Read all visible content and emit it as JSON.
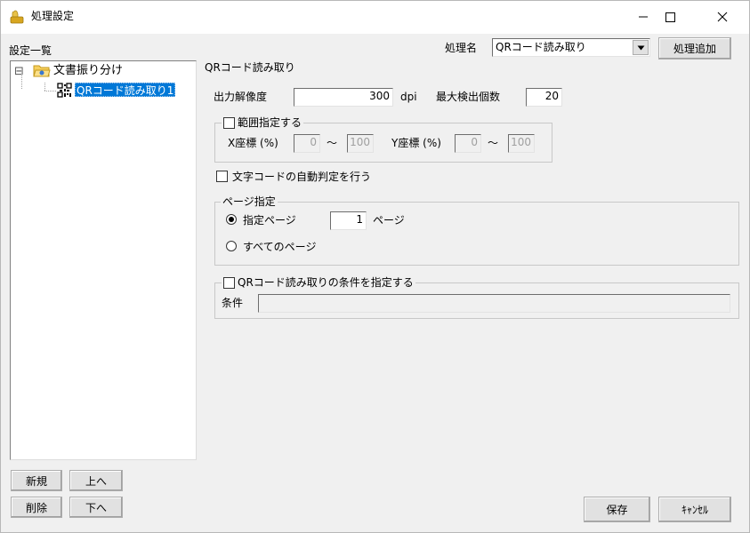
{
  "window": {
    "title": "処理設定"
  },
  "sidebar": {
    "heading": "設定一覧",
    "tree": {
      "root_label": "文書振り分け",
      "root_toggle": "⊟",
      "child_label": "QRコード読み取り1"
    },
    "buttons": {
      "new": "新規",
      "up": "上へ",
      "delete": "削除",
      "down": "下へ"
    }
  },
  "header": {
    "process_name_label": "処理名",
    "process_name_value": "QRコード読み取り",
    "add_button": "処理追加"
  },
  "panel": {
    "title": "QRコード読み取り",
    "resolution_label": "出力解像度",
    "resolution_value": "300",
    "resolution_unit": "dpi",
    "max_detect_label": "最大検出個数",
    "max_detect_value": "20",
    "range": {
      "label": "範囲指定する",
      "x_label": "X座標 (%)",
      "x_from": "0",
      "tilde": "～",
      "x_to": "100",
      "y_label": "Y座標 (%)",
      "y_from": "0",
      "y_to": "100"
    },
    "auto_charcode_label": "文字コードの自動判定を行う",
    "page": {
      "group_label": "ページ指定",
      "specified_label": "指定ページ",
      "page_value": "1",
      "page_unit": "ページ",
      "all_pages_label": "すべてのページ"
    },
    "condition": {
      "check_label": "QRコード読み取りの条件を指定する",
      "field_label": "条件",
      "field_value": ""
    }
  },
  "footer": {
    "save": "保存",
    "cancel": "ｷｬﾝｾﾙ"
  },
  "colors": {
    "selection": "#0078d7",
    "face": "#f0f0f0",
    "button": "#e1e1e1"
  }
}
